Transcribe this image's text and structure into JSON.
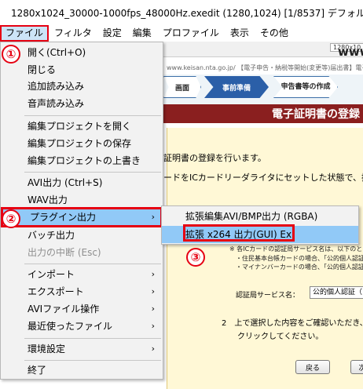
{
  "window": {
    "title": "1280x1024_30000-1000fps_48000Hz.exedit (1280,1024)  [1/8537]  デフォルト"
  },
  "menubar": [
    "ファイル",
    "フィルタ",
    "設定",
    "編集",
    "プロファイル",
    "表示",
    "その他"
  ],
  "file_menu": {
    "items": [
      {
        "label": "開く(Ctrl+O)"
      },
      {
        "label": "閉じる"
      },
      {
        "label": "追加読み込み"
      },
      {
        "label": "音声読み込み"
      },
      {
        "label": "編集プロジェクトを開く"
      },
      {
        "label": "編集プロジェクトの保存"
      },
      {
        "label": "編集プロジェクトの上書き"
      },
      {
        "label": "AVI出力 (Ctrl+S)"
      },
      {
        "label": "WAV出力"
      },
      {
        "label": "プラグイン出力",
        "submenu": true,
        "highlighted": true
      },
      {
        "label": "バッチ出力"
      },
      {
        "label": "出力の中断 (Esc)",
        "disabled": true
      },
      {
        "label": "インポート",
        "submenu": true
      },
      {
        "label": "エクスポート",
        "submenu": true
      },
      {
        "label": "AVIファイル操作",
        "submenu": true
      },
      {
        "label": "最近使ったファイル",
        "submenu": true
      },
      {
        "label": "環境設定",
        "submenu": true
      },
      {
        "label": "終了"
      }
    ],
    "arrow_glyph": "›"
  },
  "plugin_submenu": {
    "items": [
      {
        "label": "拡張編集AVI/BMP出力 (RGBA)"
      },
      {
        "label": "拡張 x264 出力(GUI) Ex",
        "selected": true
      }
    ]
  },
  "markers": [
    "①",
    "②",
    "③"
  ],
  "background_page": {
    "tab_label": "1280x10...",
    "brand_text": "www.BA",
    "address_text": "www.keisan.nta.go.jp/ 【電子申告・納税等開始(変更等)届出書】電子証明書の登録・再登録 - Internet",
    "steps": [
      "画面",
      "事前準備",
      "申告書等の作成"
    ],
    "heading": "電子証明書の登録",
    "para1": "証明書の登録を行います。",
    "para2": "ードをICカードリーダライタにセットした状態で、操",
    "note_a": "※ 各ICカードの認証局サービス名は、以下のと",
    "note_b": "・住民基本台帳カードの場合、「公的個人認証",
    "note_c": "・マイナンバーカードの場合、「公的個人認証",
    "service_label": "認証局サービス名：",
    "service_value": "公的個人認証（マ",
    "step2_a": "2　上で選択した内容をご確認いただき、",
    "step2_b": "クリックしてください。",
    "back_button": "戻る",
    "next_button": "次"
  },
  "colors": {
    "annotation_red": "#e60012",
    "highlight_blue": "#91c9f7",
    "heading_maroon": "#8a1f1f"
  }
}
